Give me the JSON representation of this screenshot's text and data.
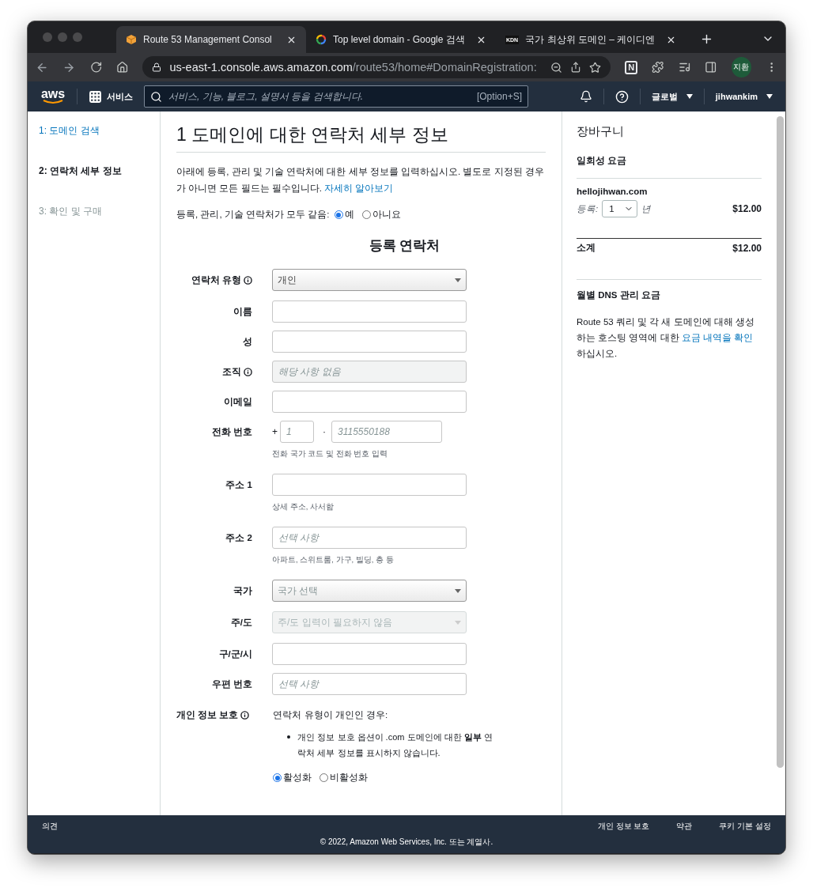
{
  "browser": {
    "tabs": [
      {
        "title": "Route 53 Management Consol",
        "kind": "cube",
        "selected": true
      },
      {
        "title": "Top level domain - Google 검색",
        "kind": "ring",
        "selected": false
      },
      {
        "title": "국가 최상위 도메인 – 케이디엔",
        "kind": "badge",
        "badge": "KDN",
        "selected": false
      }
    ],
    "address": {
      "host": "us-east-1.console.aws.amazon.com",
      "path": "/route53/home#DomainRegistration:"
    },
    "extension_badge": "N",
    "profile": "지환"
  },
  "aws_nav": {
    "logo": "aws",
    "services": "서비스",
    "search_placeholder": "서비스, 기능, 블로그, 설명서 등을 검색합니다.",
    "shortcut": "[Option+S]",
    "region": "글로벌",
    "user": "jihwankim"
  },
  "steps": [
    {
      "label": "1: 도메인 검색",
      "selected": false,
      "disabled": false
    },
    {
      "label": "2: 연락처 세부 정보",
      "selected": true,
      "disabled": false
    },
    {
      "label": "3: 확인 및 구매",
      "selected": false,
      "disabled": true
    }
  ],
  "main": {
    "title": "1 도메인에 대한 연락처 세부 정보",
    "intro": "아래에 등록, 관리 및 기술 연락처에 대한 세부 정보를 입력하십시오. 별도로 지정된 경우가 아니면 모든 필드는 필수입니다.",
    "intro_link": "자세히 알아보기",
    "same_contacts": {
      "label": "등록, 관리, 기술 연락처가 모두 같음:",
      "options": [
        {
          "label": "예",
          "selected": true
        },
        {
          "label": "아니요",
          "selected": false
        }
      ]
    },
    "section_title": "등록 연락처",
    "fields": [
      {
        "label": "연락처 유형",
        "info": true,
        "kind": "select",
        "value": "개인",
        "disabled": false
      },
      {
        "label": "이름",
        "info": false,
        "kind": "input",
        "disabled": false
      },
      {
        "label": "성",
        "info": false,
        "kind": "input",
        "disabled": false
      },
      {
        "label": "조직",
        "info": true,
        "kind": "input",
        "placeholder": "해당 사항 없음",
        "disabled": true
      },
      {
        "label": "이메일",
        "info": false,
        "kind": "input",
        "disabled": false
      },
      {
        "label": "전화 번호",
        "info": false,
        "kind": "phone",
        "code_prefix": "+",
        "separator": "·",
        "code_placeholder": "1",
        "number_placeholder": "3115550188",
        "help": "전화 국가 코드 및 전화 번호 입력",
        "disabled": false
      },
      {
        "label": "주소 1",
        "info": false,
        "kind": "input",
        "help": "상세 주소, 사서함",
        "disabled": false
      },
      {
        "label": "주소 2",
        "info": false,
        "kind": "input",
        "placeholder": "선택 사항",
        "help": "아파트, 스위트룸, 가구, 빌딩, 층 등",
        "disabled": false
      },
      {
        "label": "국가",
        "info": false,
        "kind": "select",
        "placeholder": "국가 선택",
        "disabled": false
      },
      {
        "label": "주/도",
        "info": false,
        "kind": "select",
        "placeholder": "주/도 입력이 필요하지 않음",
        "disabled": true
      },
      {
        "label": "구/군/시",
        "info": false,
        "kind": "input",
        "disabled": false
      },
      {
        "label": "우편 번호",
        "info": false,
        "kind": "input",
        "placeholder": "선택 사항",
        "disabled": false
      }
    ],
    "privacy": {
      "label": "개인 정보 보호",
      "info": true,
      "note": "연락처 유형이 개인인 경우:",
      "bullets": [
        "개인 정보 보호 옵션이 .com 도메인에 대한 **일부** 연락처 세부 정보를 표시하지 않습니다."
      ],
      "options": [
        {
          "label": "활성화",
          "selected": true
        },
        {
          "label": "비활성화",
          "selected": false
        }
      ]
    }
  },
  "cart": {
    "title": "장바구니",
    "one_time": "일회성 요금",
    "domain": "hellojihwan.com",
    "term_label": "등록:",
    "years": "1",
    "unit": "년",
    "price": "$12.00",
    "subtotal_label": "소계",
    "subtotal": "$12.00",
    "monthly_title": "월별 DNS 관리 요금",
    "monthly_text": "Route 53 쿼리 및 각 새 도메인에 대해 생성하는 호스팅 영역에 대한",
    "monthly_link": "요금 내역을 확인",
    "monthly_tail": "하십시오."
  },
  "footer": {
    "feedback": "의견",
    "links": [
      "개인 정보 보호",
      "약관",
      "쿠키 기본 설정"
    ],
    "copyright": "© 2022, Amazon Web Services, Inc. 또는 계열사."
  }
}
